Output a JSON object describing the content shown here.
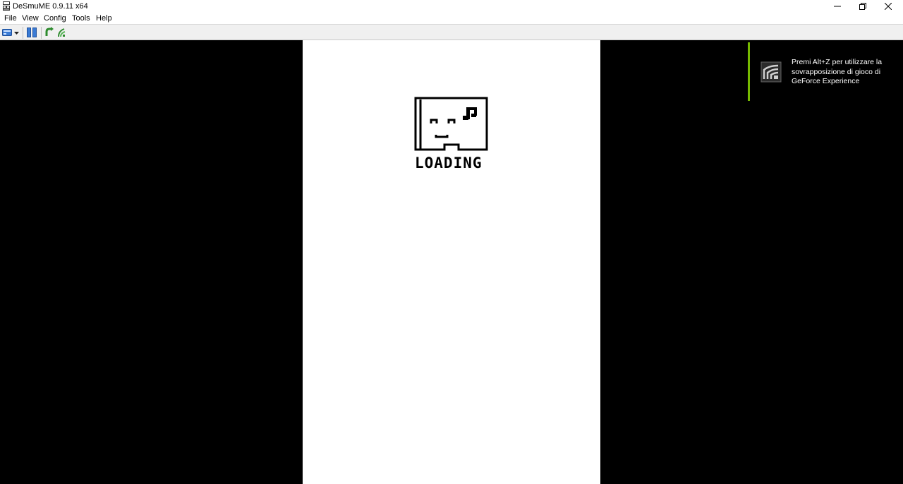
{
  "window": {
    "title": "DeSmuME 0.9.11 x64",
    "controls": {
      "minimize": "minimize-icon",
      "restore": "restore-icon",
      "close": "close-icon"
    }
  },
  "menu": {
    "file": "File",
    "view": "View",
    "config": "Config",
    "tools": "Tools",
    "help": "Help"
  },
  "toolbar": {
    "icons": [
      "open-rom-icon",
      "dropdown-arrow-icon",
      "pause-icon",
      "reset-icon",
      "wifi-icon"
    ]
  },
  "emulator": {
    "screen_status": "LOADING",
    "loading_icon": "sd-card-music-icon"
  },
  "overlay": {
    "message": "Premi Alt+Z per utilizzare la sovrapposizione di gioco di GeForce Experience",
    "icon": "geforce-share-icon",
    "accent": "#76b900"
  },
  "colors": {
    "background": "#000000",
    "screen": "#ffffff"
  }
}
